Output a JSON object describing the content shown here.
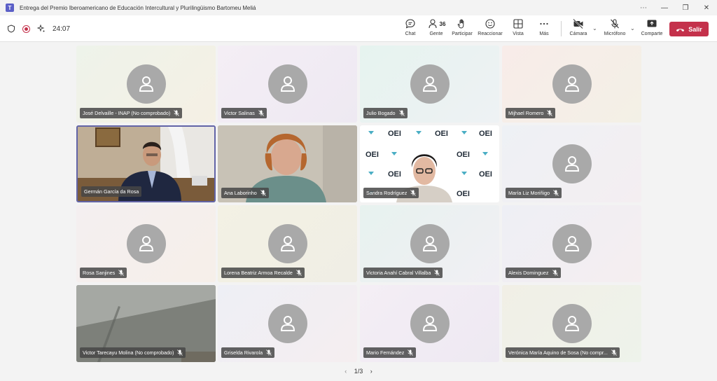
{
  "window": {
    "title": "Entrega del Premio Iberoamericano de Educación Intercultural y Plurilingüismo Bartomeu Meliá",
    "controls": [
      "⋯",
      "—",
      "❐",
      "✕"
    ]
  },
  "toolbar": {
    "timer": "24:07",
    "chat_label": "Chat",
    "people_label": "Gente",
    "people_count": "36",
    "raise_label": "Participar",
    "react_label": "Reaccionar",
    "view_label": "Vista",
    "more_label": "Más",
    "camera_label": "Cámara",
    "mic_label": "Micrófono",
    "share_label": "Comparte",
    "leave_label": "Salir"
  },
  "participants": [
    {
      "name": "José Delvaille - INAP (No comprobado)",
      "video": false
    },
    {
      "name": "Victor Salinas",
      "video": false
    },
    {
      "name": "Julio Bogado",
      "video": false
    },
    {
      "name": "Mijhael Romero",
      "video": false
    },
    {
      "name": "Germán García da Rosa",
      "video": true,
      "active_speaker": true
    },
    {
      "name": "Ana Laborinho",
      "video": true
    },
    {
      "name": "Sandra Rodríguez",
      "video": true
    },
    {
      "name": "María Liz Moriñigo",
      "video": false
    },
    {
      "name": "Rosa Sanjines",
      "video": false
    },
    {
      "name": "Lorena Beatriz Armoa Recalde",
      "video": false
    },
    {
      "name": "Victoria Anahí Cabral Villalba",
      "video": false
    },
    {
      "name": "Alexis Dominguez",
      "video": false
    },
    {
      "name": "Victor Tarecayu Molina (No comprobado)",
      "video": true
    },
    {
      "name": "Griselda Rivarola",
      "video": false
    },
    {
      "name": "Mario Fernández",
      "video": false
    },
    {
      "name": "Verónica María Aquino de Sosa (No compr...",
      "video": false
    }
  ],
  "backdrop_text": "OEI",
  "pager": {
    "label": "1/3"
  },
  "colors": {
    "leave": "#c4314b",
    "active_border": "#6264a7",
    "avatar": "#a9a9a9"
  }
}
